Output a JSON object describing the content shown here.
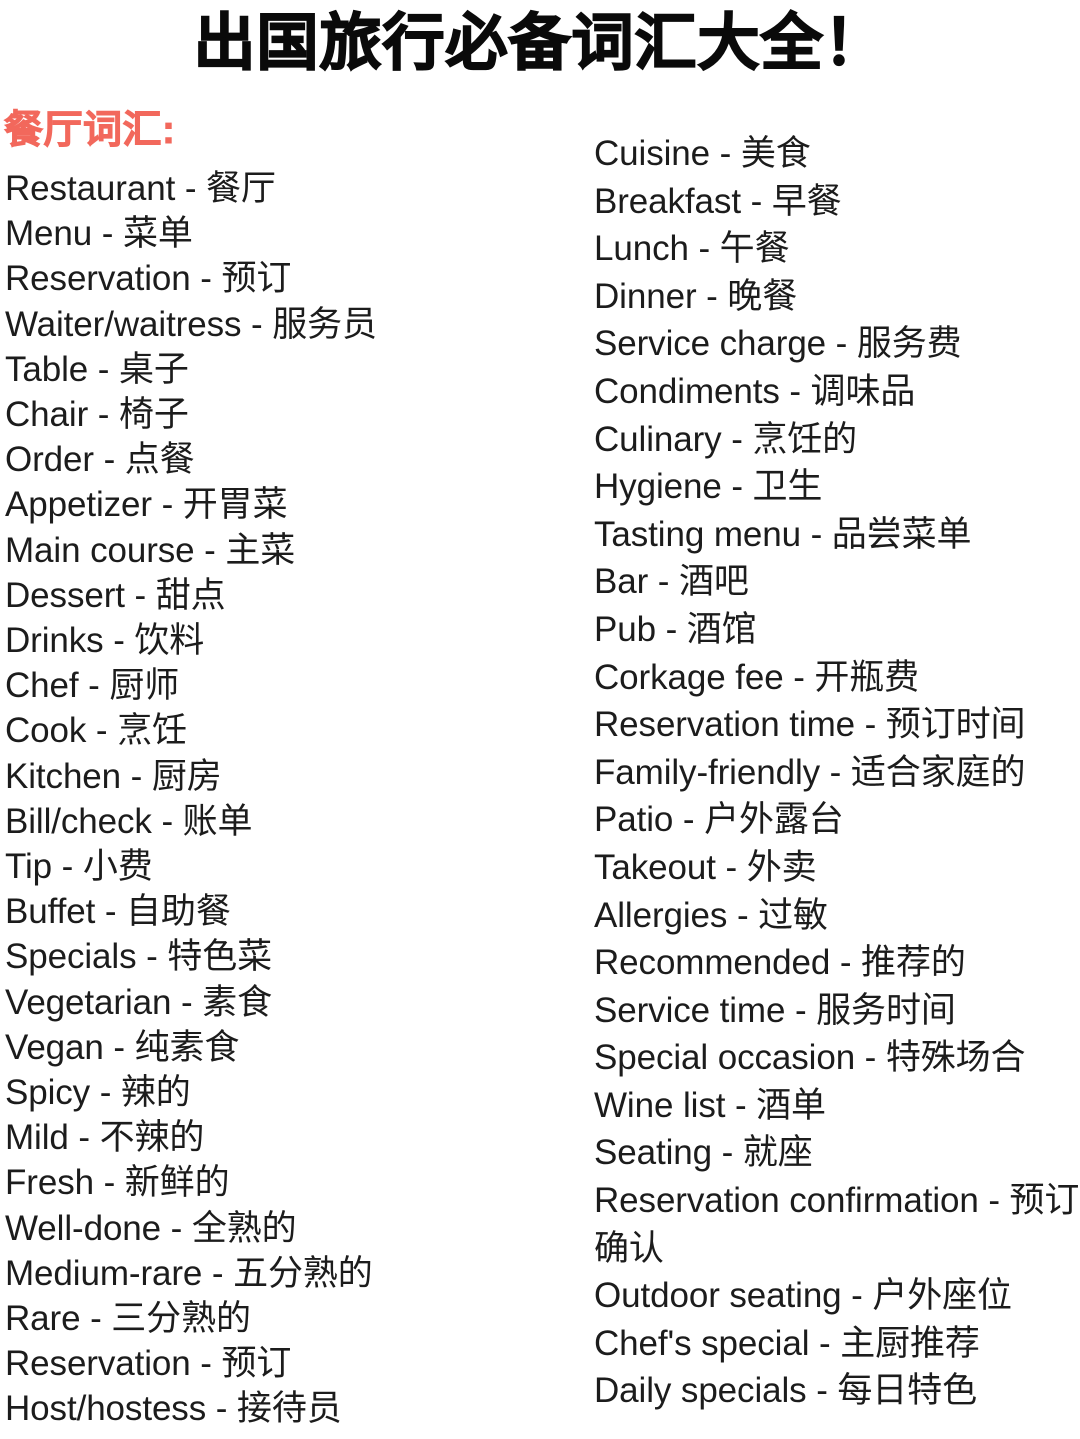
{
  "page": {
    "title": "出国旅行必备词汇大全！",
    "background_color": "#ffffff",
    "title_color": "#0a0a0a",
    "heading_color": "#f2685c",
    "body_text_color": "#1c1c1c"
  },
  "section": {
    "heading": "餐厅词汇:"
  },
  "columns": {
    "left": [
      "Restaurant - 餐厅",
      "Menu - 菜单",
      "Reservation - 预订",
      "Waiter/waitress - 服务员",
      "Table - 桌子",
      "Chair - 椅子",
      "Order - 点餐",
      "Appetizer - 开胃菜",
      "Main course - 主菜",
      "Dessert - 甜点",
      "Drinks - 饮料",
      "Chef - 厨师",
      "Cook - 烹饪",
      "Kitchen - 厨房",
      "Bill/check - 账单",
      "Tip - 小费",
      "Buffet - 自助餐",
      "Specials - 特色菜",
      "Vegetarian - 素食",
      "Vegan - 纯素食",
      "Spicy - 辣的",
      "Mild - 不辣的",
      "Fresh - 新鲜的",
      "Well-done - 全熟的",
      "Medium-rare - 五分熟的",
      "Rare - 三分熟的",
      "Reservation - 预订",
      "Host/hostess - 接待员"
    ],
    "right": [
      "Cuisine - 美食",
      "Breakfast - 早餐",
      "Lunch - 午餐",
      "Dinner - 晚餐",
      "Service charge - 服务费",
      "Condiments - 调味品",
      "Culinary - 烹饪的",
      "Hygiene - 卫生",
      "Tasting menu - 品尝菜单",
      "Bar - 酒吧",
      "Pub - 酒馆",
      "Corkage fee - 开瓶费",
      "Reservation time - 预订时间",
      "Family-friendly - 适合家庭的",
      "Patio - 户外露台",
      "Takeout - 外卖",
      "Allergies - 过敏",
      "Recommended - 推荐的",
      "Service time - 服务时间",
      "Special occasion - 特殊场合",
      "Wine list - 酒单",
      "Seating - 就座",
      "Reservation confirmation - 预订确认",
      "Outdoor seating - 户外座位",
      "Chef's special - 主厨推荐",
      "Daily specials - 每日特色"
    ]
  }
}
